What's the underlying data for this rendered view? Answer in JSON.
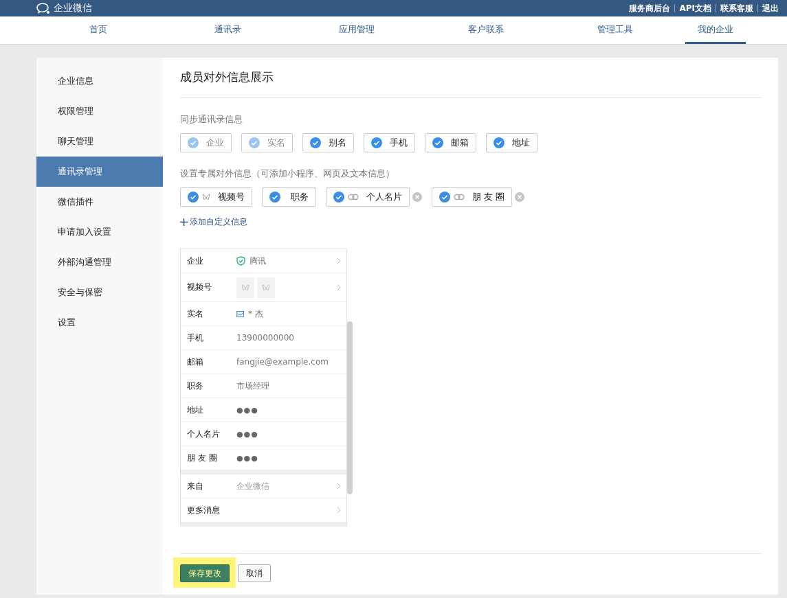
{
  "topbar": {
    "brand": "企业微信",
    "links": [
      "服务商后台",
      "API文档",
      "联系客服",
      "退出"
    ]
  },
  "nav": [
    {
      "label": "首页",
      "selected": false
    },
    {
      "label": "通讯录",
      "selected": false
    },
    {
      "label": "应用管理",
      "selected": false
    },
    {
      "label": "客户联系",
      "selected": false
    },
    {
      "label": "管理工具",
      "selected": false
    },
    {
      "label": "我的企业",
      "selected": true
    }
  ],
  "sidebar": {
    "items": [
      {
        "label": "企业信息",
        "selected": false
      },
      {
        "label": "权限管理",
        "selected": false
      },
      {
        "label": "聊天管理",
        "selected": false
      },
      {
        "label": "通讯录管理",
        "selected": true
      },
      {
        "label": "微信插件",
        "selected": false
      },
      {
        "label": "申请加入设置",
        "selected": false
      },
      {
        "label": "外部沟通管理",
        "selected": false
      },
      {
        "label": "安全与保密",
        "selected": false
      },
      {
        "label": "设置",
        "selected": false
      }
    ]
  },
  "title": "成员对外信息展示",
  "sync": {
    "label": "同步通讯录信息",
    "options": [
      {
        "label": "企业",
        "checked": true,
        "disabled": true
      },
      {
        "label": "实名",
        "checked": true,
        "disabled": true
      },
      {
        "label": "别名",
        "checked": true,
        "disabled": false
      },
      {
        "label": "手机",
        "checked": true,
        "disabled": false
      },
      {
        "label": "邮箱",
        "checked": true,
        "disabled": false
      },
      {
        "label": "地址",
        "checked": true,
        "disabled": false
      }
    ]
  },
  "custom": {
    "label": "设置专属对外信息（可添加小程序、网页及文本信息）",
    "options": [
      {
        "label": "视频号",
        "checked": true,
        "kind": "video",
        "removable": false
      },
      {
        "label": "职务",
        "checked": true,
        "kind": "plain",
        "removable": false
      },
      {
        "label": "个人名片",
        "checked": true,
        "kind": "link",
        "removable": true
      },
      {
        "label": "朋 友 圈",
        "checked": true,
        "kind": "link",
        "removable": true
      }
    ],
    "add": "添加自定义信息"
  },
  "preview": {
    "groups": [
      [
        {
          "label": "企业",
          "value": "腾讯",
          "kind": "verified",
          "arrow": true
        },
        {
          "label": "视频号",
          "kind": "tiles",
          "arrow": true
        },
        {
          "label": "实名",
          "value": "* 杰",
          "kind": "card",
          "arrow": false
        },
        {
          "label": "手机",
          "value": "13900000000",
          "kind": "text",
          "arrow": false
        },
        {
          "label": "邮箱",
          "value": "fangjie@example.com",
          "kind": "text",
          "arrow": false
        },
        {
          "label": "职务",
          "value": "市场经理",
          "kind": "text",
          "arrow": false
        },
        {
          "label": "地址",
          "value": "●●●",
          "kind": "dots",
          "arrow": false
        },
        {
          "label": "个人名片",
          "value": "●●●",
          "kind": "dots",
          "arrow": false
        },
        {
          "label": "朋 友 圈",
          "value": "●●●",
          "kind": "dots",
          "arrow": false
        }
      ],
      [
        {
          "label": "来自",
          "value": "企业微信",
          "kind": "muted",
          "arrow": true
        },
        {
          "label": "更多消息",
          "kind": "none",
          "arrow": true
        }
      ]
    ]
  },
  "buttons": {
    "save": "保存更改",
    "cancel": "取消",
    "save_highlighted": true
  }
}
